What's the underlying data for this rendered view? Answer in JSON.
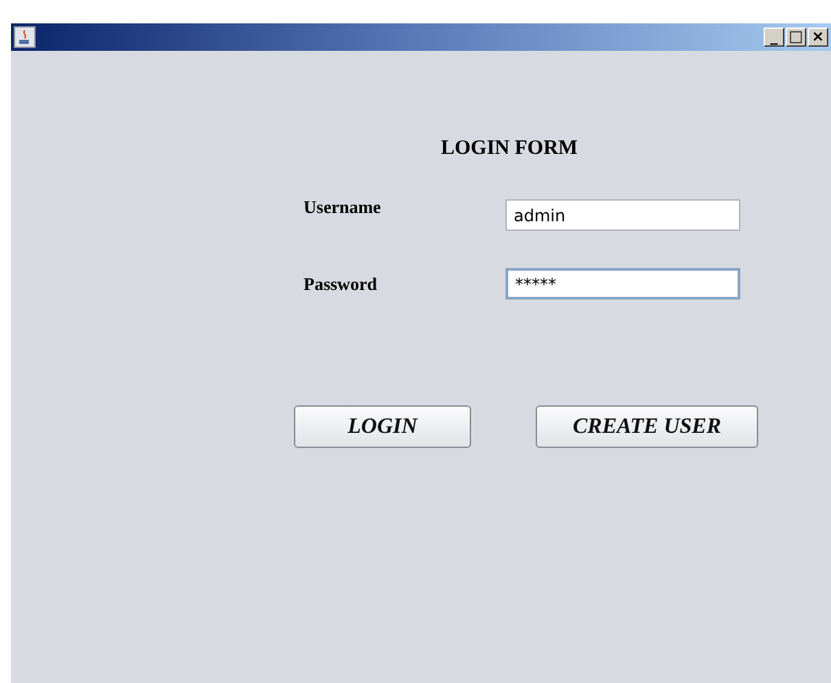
{
  "window": {
    "title_buttons": [
      "_",
      "□",
      "×"
    ]
  },
  "form": {
    "heading": "LOGIN FORM",
    "fields": [
      {
        "label": "Username",
        "value": "admin",
        "focused": false
      },
      {
        "label": "Password",
        "value": "*****",
        "focused": true
      }
    ],
    "buttons": [
      "LOGIN",
      "CREATE USER"
    ]
  }
}
